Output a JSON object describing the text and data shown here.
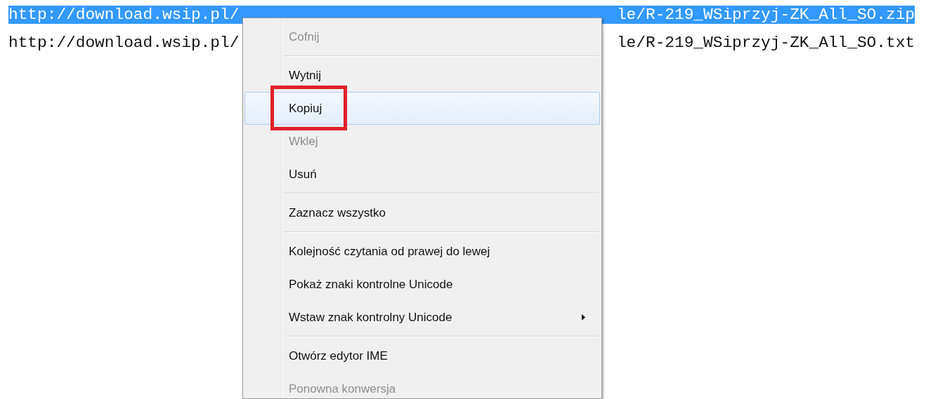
{
  "text_lines": [
    {
      "left": "http://download.wsip.pl/",
      "right": "le/R-219_WSiprzyj-ZK_All_SO.zip",
      "selected": true
    },
    {
      "left": "http://download.wsip.pl/",
      "right": "le/R-219_WSiprzyj-ZK_All_SO.txt",
      "selected": false
    }
  ],
  "context_menu": {
    "items": [
      {
        "kind": "item",
        "label": "Cofnij",
        "disabled": true,
        "selected": false
      },
      {
        "kind": "separator"
      },
      {
        "kind": "item",
        "label": "Wytnij",
        "disabled": false,
        "selected": false
      },
      {
        "kind": "item",
        "label": "Kopiuj",
        "disabled": false,
        "selected": true,
        "annotated": true
      },
      {
        "kind": "item",
        "label": "Wklej",
        "disabled": true,
        "selected": false
      },
      {
        "kind": "item",
        "label": "Usuń",
        "disabled": false,
        "selected": false
      },
      {
        "kind": "separator"
      },
      {
        "kind": "item",
        "label": "Zaznacz wszystko",
        "disabled": false,
        "selected": false
      },
      {
        "kind": "separator"
      },
      {
        "kind": "item",
        "label": "Kolejność czytania od prawej do lewej",
        "disabled": false,
        "selected": false
      },
      {
        "kind": "item",
        "label": "Pokaż znaki kontrolne Unicode",
        "disabled": false,
        "selected": false
      },
      {
        "kind": "submenu",
        "label": "Wstaw znak kontrolny Unicode",
        "disabled": false,
        "selected": false
      },
      {
        "kind": "separator"
      },
      {
        "kind": "item",
        "label": "Otwórz edytor IME",
        "disabled": false,
        "selected": false
      },
      {
        "kind": "item",
        "label": "Ponowna konwersja",
        "disabled": true,
        "selected": false
      }
    ]
  }
}
